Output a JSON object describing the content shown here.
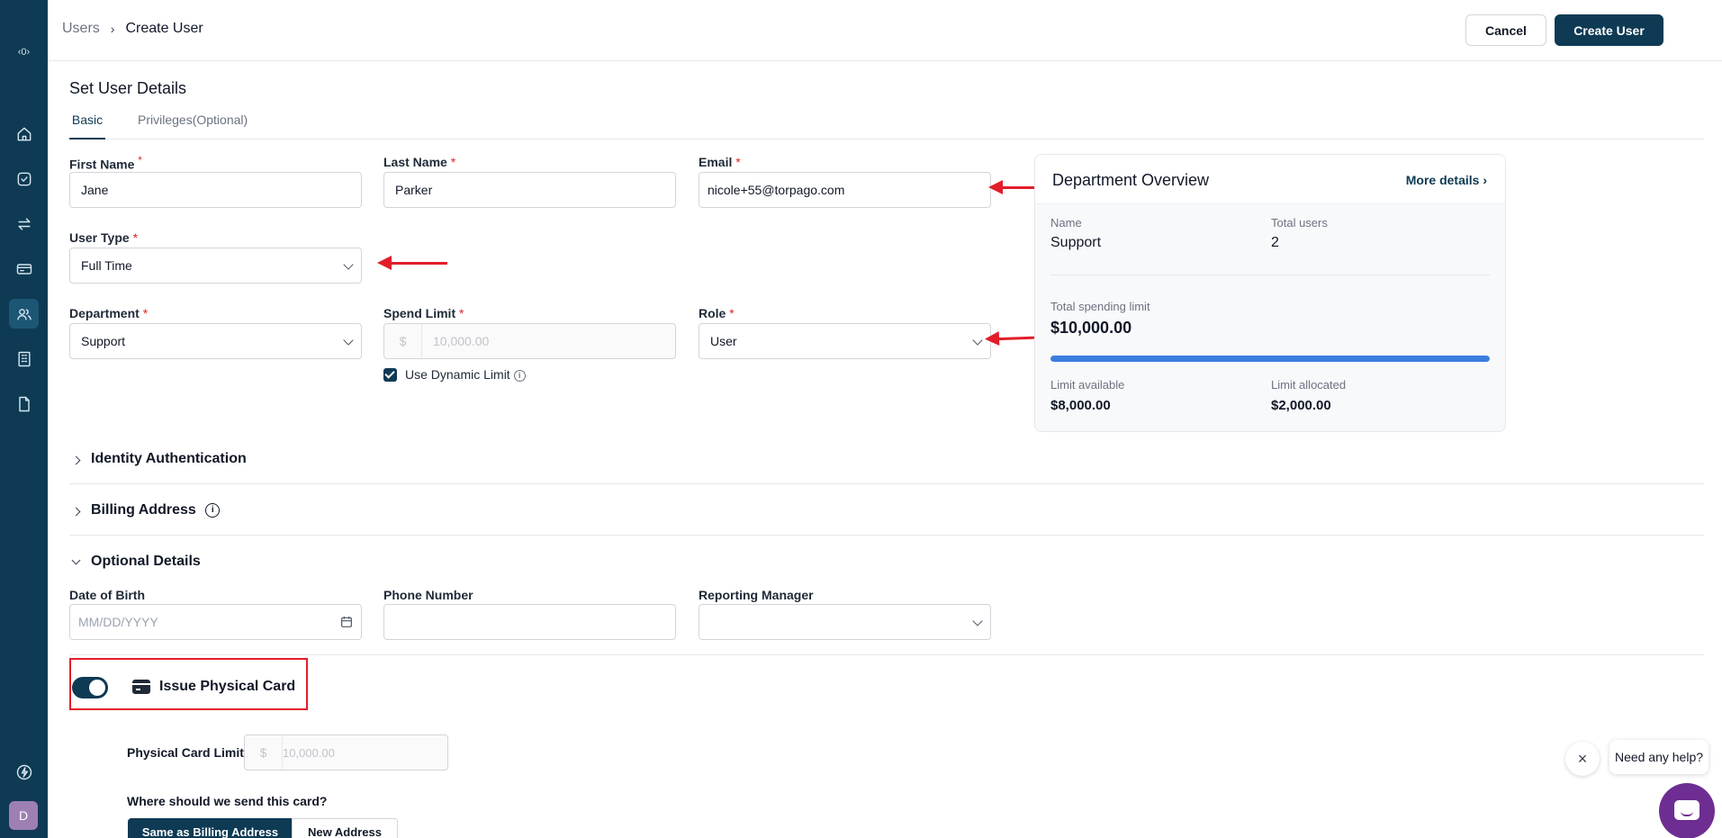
{
  "sidebar": {
    "logo": "‹0›",
    "items": [
      {
        "icon": "home-icon"
      },
      {
        "icon": "check-circle-icon"
      },
      {
        "icon": "transfer-icon"
      },
      {
        "icon": "card-icon"
      },
      {
        "icon": "users-icon",
        "active": true
      },
      {
        "icon": "building-icon"
      },
      {
        "icon": "document-icon"
      }
    ],
    "bottom_icon": "lightning-icon",
    "avatar_initial": "D"
  },
  "header": {
    "breadcrumb_root": "Users",
    "breadcrumb_current": "Create User",
    "cancel_label": "Cancel",
    "create_label": "Create User"
  },
  "form": {
    "title": "Set User Details",
    "tabs": [
      {
        "label": "Basic",
        "active": true
      },
      {
        "label": "Privileges(Optional)",
        "active": false
      }
    ],
    "first_name": {
      "label": "First Name",
      "value": "Jane"
    },
    "last_name": {
      "label": "Last Name",
      "value": "Parker"
    },
    "email": {
      "label": "Email",
      "value": "nicole+55@torpago.com"
    },
    "user_type": {
      "label": "User Type",
      "value": "Full Time"
    },
    "department": {
      "label": "Department",
      "value": "Support"
    },
    "spend_limit": {
      "label": "Spend Limit",
      "prefix": "$",
      "placeholder": "10,000.00"
    },
    "dynamic_limit": {
      "label": "Use Dynamic Limit",
      "checked": true
    },
    "role": {
      "label": "Role",
      "value": "User"
    },
    "required_mark": "*"
  },
  "department_overview": {
    "title": "Department Overview",
    "more_link": "More details",
    "name_label": "Name",
    "name_value": "Support",
    "users_label": "Total users",
    "users_value": "2",
    "spending_label": "Total spending limit",
    "spending_value": "$10,000.00",
    "available_label": "Limit available",
    "available_value": "$8,000.00",
    "allocated_label": "Limit allocated",
    "allocated_value": "$2,000.00",
    "progress_fraction": 1.0,
    "progress_color": "#3b7ddd"
  },
  "sections": {
    "identity": "Identity Authentication",
    "billing": "Billing Address",
    "optional": "Optional Details"
  },
  "optional": {
    "dob": {
      "label": "Date of Birth",
      "placeholder": "MM/DD/YYYY"
    },
    "phone": {
      "label": "Phone Number"
    },
    "manager": {
      "label": "Reporting Manager"
    }
  },
  "physical_card": {
    "toggle_label": "Issue Physical Card",
    "enabled": true,
    "limit_label": "Physical Card Limit:",
    "limit_prefix": "$",
    "limit_placeholder": "10,000.00",
    "send_question": "Where should we send this card?",
    "option_same": "Same as Billing Address",
    "option_new": "New Address"
  },
  "help": {
    "bubble": "Need any help?",
    "close": "×"
  },
  "colors": {
    "brand": "#0e3a54",
    "annotation": "#e11d2a",
    "help_fab": "#6e2d92"
  }
}
